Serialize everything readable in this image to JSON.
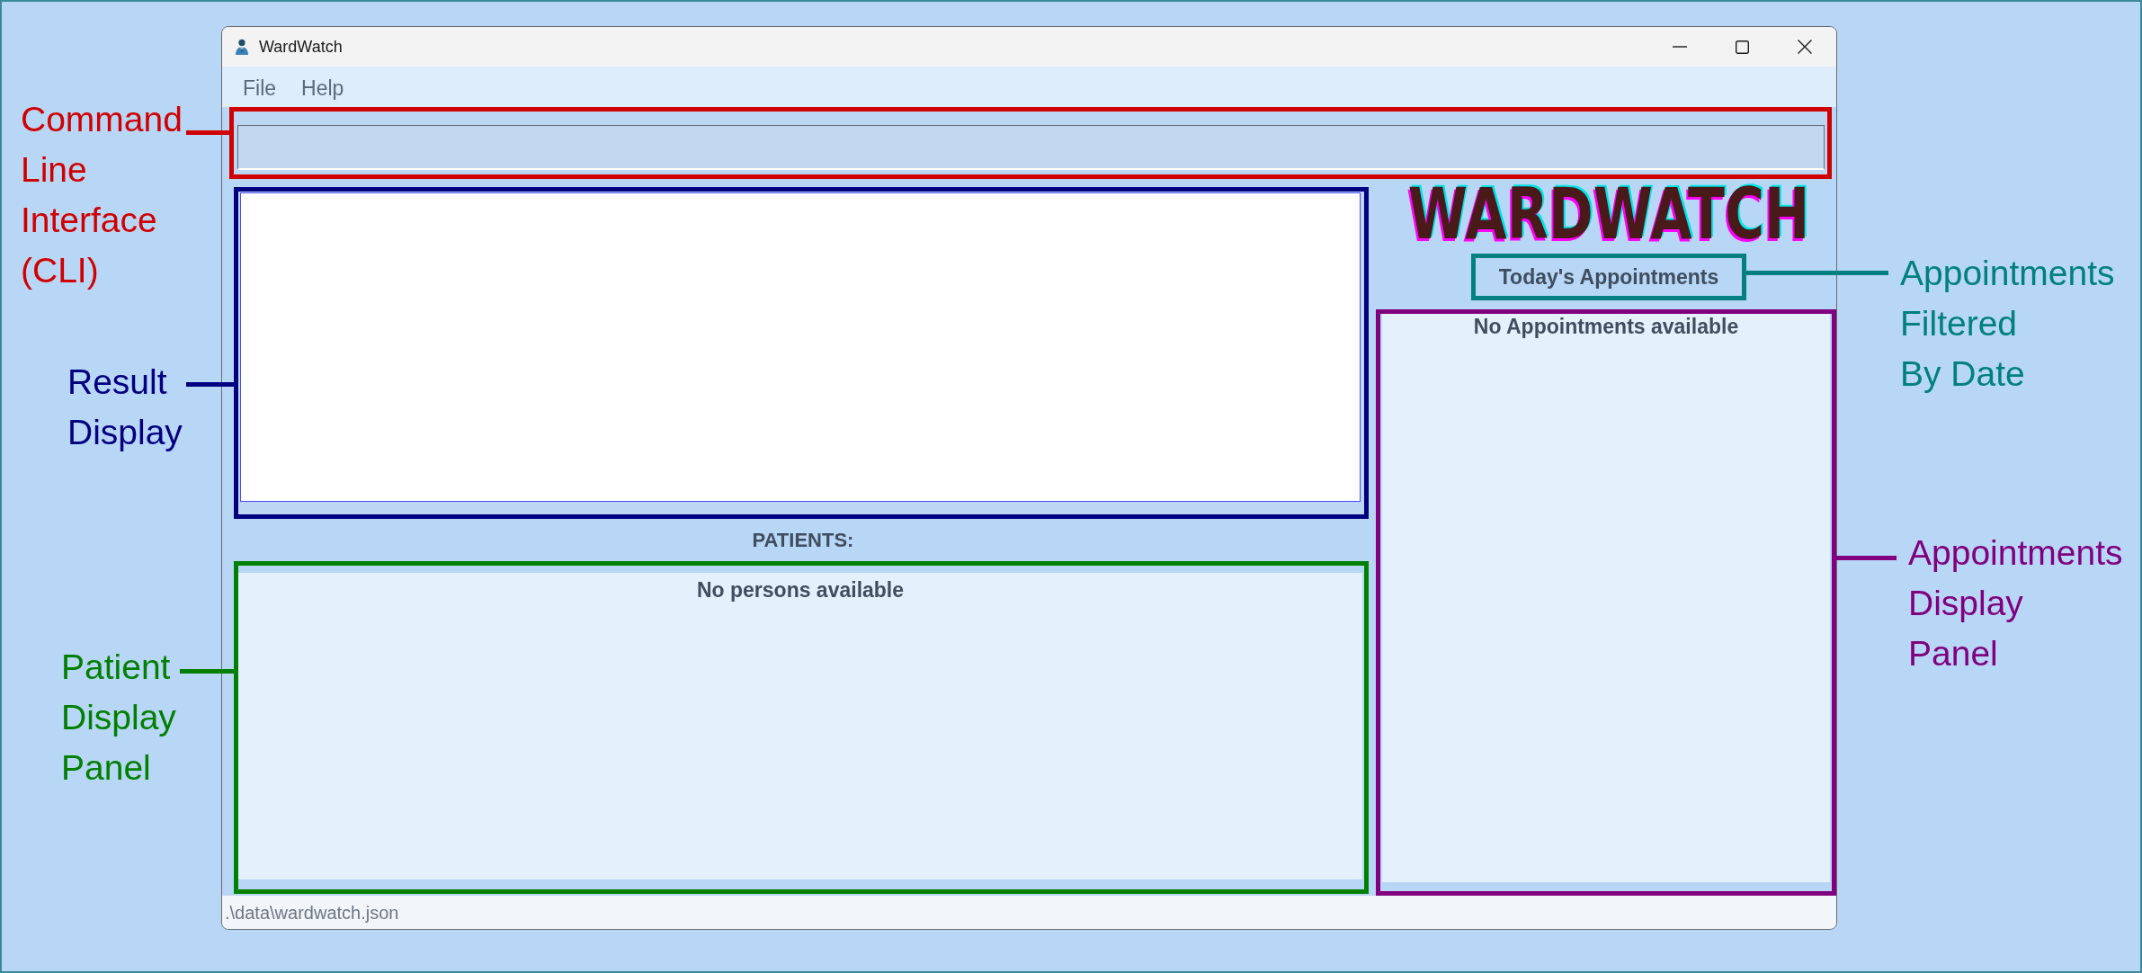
{
  "window": {
    "title": "WardWatch"
  },
  "menu_bar": [
    {
      "label": "File"
    },
    {
      "label": "Help"
    }
  ],
  "patients": {
    "heading": "PATIENTS:",
    "empty_message": "No persons available"
  },
  "logo": "WARDWATCH",
  "appointments": {
    "heading": "Today's Appointments",
    "empty_message": "No Appointments available"
  },
  "status_bar": {
    "file_path": ".\\data\\wardwatch.json"
  },
  "annotations": [
    {
      "text": "Command\nLine\nInterface\n(CLI)",
      "color": "#d00000"
    },
    {
      "text": "Result\nDisplay",
      "color": "#000080"
    },
    {
      "text": "Patient\nDisplay\nPanel",
      "color": "#008000"
    },
    {
      "text": "Appointments\nFiltered\nBy Date",
      "color": "#008080"
    },
    {
      "text": "Appointments\nDisplay\nPanel",
      "color": "#800080"
    }
  ]
}
